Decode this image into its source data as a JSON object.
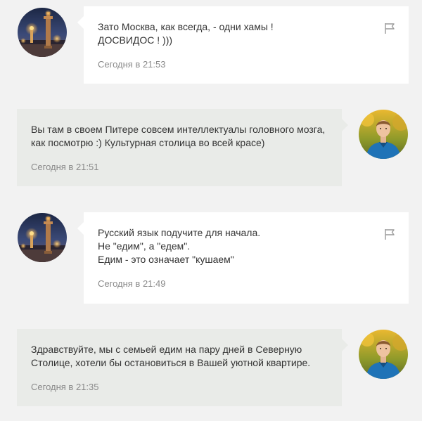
{
  "messages": [
    {
      "author": "other",
      "text": "Зато Москва, как всегда, - одни хамы !\nДОСВИДОС ! )))",
      "time": "Сегодня в 21:53"
    },
    {
      "author": "self",
      "text": "Вы там в своем Питере совсем интеллектуалы головного мозга,\nкак посмотрю :) Культурная столица во всей красе)",
      "time": "Сегодня в 21:51"
    },
    {
      "author": "other",
      "text": "Русский язык подучите для начала.\nНе \"едим\", а \"едем\".\nЕдим - это означает \"кушаем\"",
      "time": "Сегодня в 21:49"
    },
    {
      "author": "self",
      "text": "Здравствуйте, мы с семьей едим на пару дней в Северную\nСтолице, хотели бы остановиться в Вашей уютной квартире.",
      "time": "Сегодня в 21:35"
    }
  ],
  "icons": {
    "report": "flag-icon",
    "avatar_other": "rostral-column-night-photo",
    "avatar_self": "man-in-blue-polo-photo"
  },
  "colors": {
    "page_bg": "#f2f2f2",
    "incoming_bubble": "#ffffff",
    "outgoing_bubble": "#e9ebe8",
    "text": "#333333",
    "time": "#8a8a8a"
  }
}
